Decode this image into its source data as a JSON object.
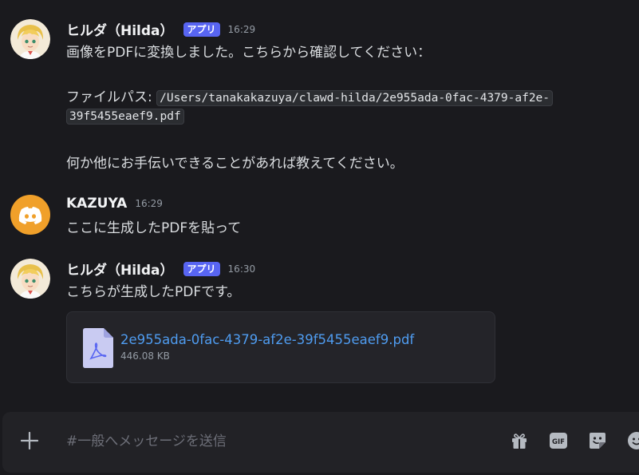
{
  "messages": [
    {
      "author": "ヒルダ（Hilda）",
      "badge": "アプリ",
      "time": "16:29",
      "lines": {
        "intro": "画像をPDFに変換しました。こちらから確認してください：",
        "path_label": "ファイルパス: ",
        "path_part1": "/Users/tanakakazuya/clawd-hilda/2e955ada-0fac-4379-af2e-",
        "path_part2": "39f5455eaef9.pdf",
        "outro": "何か他にお手伝いできることがあれば教えてください。"
      },
      "avatar_icon": "anime-boy-avatar"
    },
    {
      "author": "KAZUYA",
      "time": "16:29",
      "text": "ここに生成したPDFを貼って",
      "avatar_icon": "discord-logo-avatar",
      "avatar_color": "#f0a02a"
    },
    {
      "author": "ヒルダ（Hilda）",
      "badge": "アプリ",
      "time": "16:30",
      "text": "こちらが生成したPDFです。",
      "avatar_icon": "anime-boy-avatar",
      "attachment": {
        "file_name": "2e955ada-0fac-4379-af2e-39f5455eaef9.pdf",
        "file_size": "446.08 KB",
        "icon": "pdf-file-icon"
      }
    }
  ],
  "composer": {
    "placeholder": "#一般へメッセージを送信",
    "tools": [
      "gift-icon",
      "gif-icon",
      "sticker-icon",
      "emoji-icon"
    ]
  },
  "colors": {
    "background": "#1a1a1e",
    "badge": "#5865f2",
    "link": "#4f9cf0",
    "discord_avatar": "#f0a02a"
  }
}
